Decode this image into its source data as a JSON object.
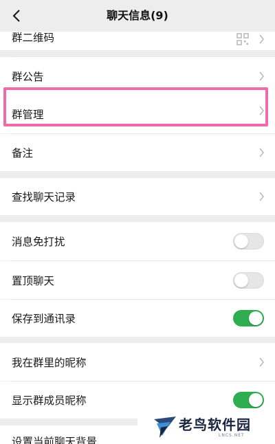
{
  "header": {
    "title": "聊天信息(9)"
  },
  "rows": {
    "qr_code": {
      "label": "群二维码"
    },
    "announcement": {
      "label": "群公告"
    },
    "manage": {
      "label": "群管理"
    },
    "remark": {
      "label": "备注"
    },
    "search_history": {
      "label": "查找聊天记录"
    },
    "mute": {
      "label": "消息免打扰",
      "on": false
    },
    "pin": {
      "label": "置顶聊天",
      "on": false
    },
    "save_contacts": {
      "label": "保存到通讯录",
      "on": true
    },
    "my_nickname": {
      "label": "我在群里的昵称"
    },
    "show_nicknames": {
      "label": "显示群成员昵称",
      "on": true
    },
    "background": {
      "label": "设置当前聊天背景"
    }
  },
  "watermark": {
    "name": "老鸟软件园",
    "sub": "LNCS.NET"
  },
  "colors": {
    "toggle_on": "#2eae51",
    "highlight": "#ef6aa8",
    "background": "#ededed"
  },
  "icons": {
    "back": "chevron-left-icon",
    "chevron": "chevron-right-icon",
    "qr": "qr-code-icon",
    "logo": "bird-logo-icon"
  }
}
